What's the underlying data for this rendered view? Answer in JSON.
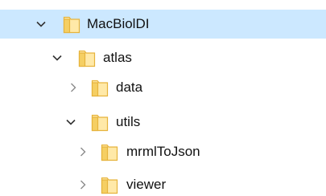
{
  "tree": {
    "items": [
      {
        "label": "MacBiolDI",
        "expanded": true,
        "selected": true
      },
      {
        "label": "atlas",
        "expanded": true,
        "selected": false
      },
      {
        "label": "data",
        "expanded": false,
        "selected": false
      },
      {
        "label": "utils",
        "expanded": true,
        "selected": false
      },
      {
        "label": "mrmlToJson",
        "expanded": false,
        "selected": false
      },
      {
        "label": "viewer",
        "expanded": false,
        "selected": false
      }
    ]
  },
  "colors": {
    "selection_bg": "#cce8ff",
    "folder_fill": "#ffe9a8",
    "folder_edge": "#e6b33c",
    "chevron_expanded": "#333333",
    "chevron_collapsed": "#8a8a8a"
  },
  "icons": {
    "expanded": "chevron-down-icon",
    "collapsed": "chevron-right-icon",
    "folder": "folder-icon"
  }
}
